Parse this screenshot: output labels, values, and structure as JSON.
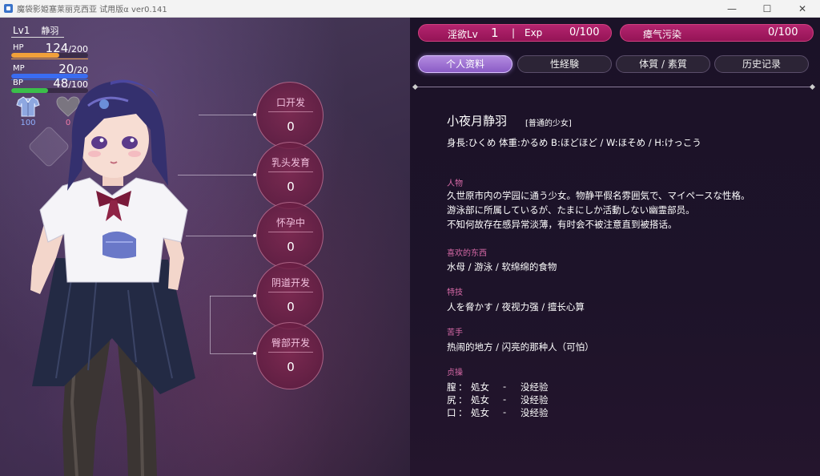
{
  "window": {
    "title": "魔袋影姫塞莱丽克西亚 试用版α ver0.141",
    "minimize": "—",
    "maximize": "☐",
    "close": "✕"
  },
  "status": {
    "level": "Lv1",
    "char_name": "静羽",
    "hp": {
      "label": "HP",
      "current": "124",
      "max": "/200",
      "fill": 0.62,
      "color": "#f0a03a"
    },
    "mp": {
      "label": "MP",
      "current": "20",
      "max": "/20",
      "fill": 1.0,
      "color": "#3a6cf0"
    },
    "bp": {
      "label": "BP",
      "current": "48",
      "max": "/100",
      "fill": 0.48,
      "color": "#3bbf4a"
    },
    "clothes_value": "100",
    "heart_value": "0"
  },
  "development": [
    {
      "title": "口开发",
      "value": "0"
    },
    {
      "title": "乳头发育",
      "value": "0"
    },
    {
      "title": "怀孕中",
      "value": "0"
    },
    {
      "title": "阴道开发",
      "value": "0"
    },
    {
      "title": "臀部开发",
      "value": "0"
    }
  ],
  "topbars": {
    "lust_label": "淫欲Lv",
    "lust_level": "1",
    "exp_label": "Exp",
    "exp_value": "0/100",
    "miasma_label": "瘴气污染",
    "miasma_value": "0/100"
  },
  "tabs": [
    "个人资料",
    "性経験",
    "体質 / 素質",
    "历史记录"
  ],
  "profile": {
    "name": "小夜月静羽",
    "tag": "[普通的少女]",
    "body": "身長:ひくめ 体重:かるめ B:ほどほど / W:ほそめ / H:けっこう",
    "person_head": "人物",
    "person_lines": [
      "久世原市内の学园に通う少女。物静平假名雰囲気で、マイペースな性格。",
      "游泳部に所属しているが、たまにしか活動しない幽霊部员。",
      "不知何故存在感异常淡薄，有时会不被注意直到被搭话。"
    ],
    "likes_head": "喜欢的东西",
    "likes": "水母 / 游泳 / 软绵绵的食物",
    "skill_head": "特技",
    "skill": "人を脅かす / 夜视力强 / 擅长心算",
    "weak_head": "苦手",
    "weak": "热闹的地方 / 闪亮的那种人（可怕）",
    "chastity_head": "贞操",
    "chastity": [
      {
        "part": "膣",
        "colon": "：",
        "state": "処女",
        "dash": "-",
        "exp": "没经验"
      },
      {
        "part": "尻",
        "colon": "：",
        "state": "処女",
        "dash": "-",
        "exp": "没经验"
      },
      {
        "part": "口",
        "colon": "：",
        "state": "処女",
        "dash": "-",
        "exp": "没经验"
      }
    ]
  },
  "colors": {
    "accent_pink": "#b4246f",
    "tab_active": "#a77ad8",
    "section_head": "#d86aa8"
  }
}
